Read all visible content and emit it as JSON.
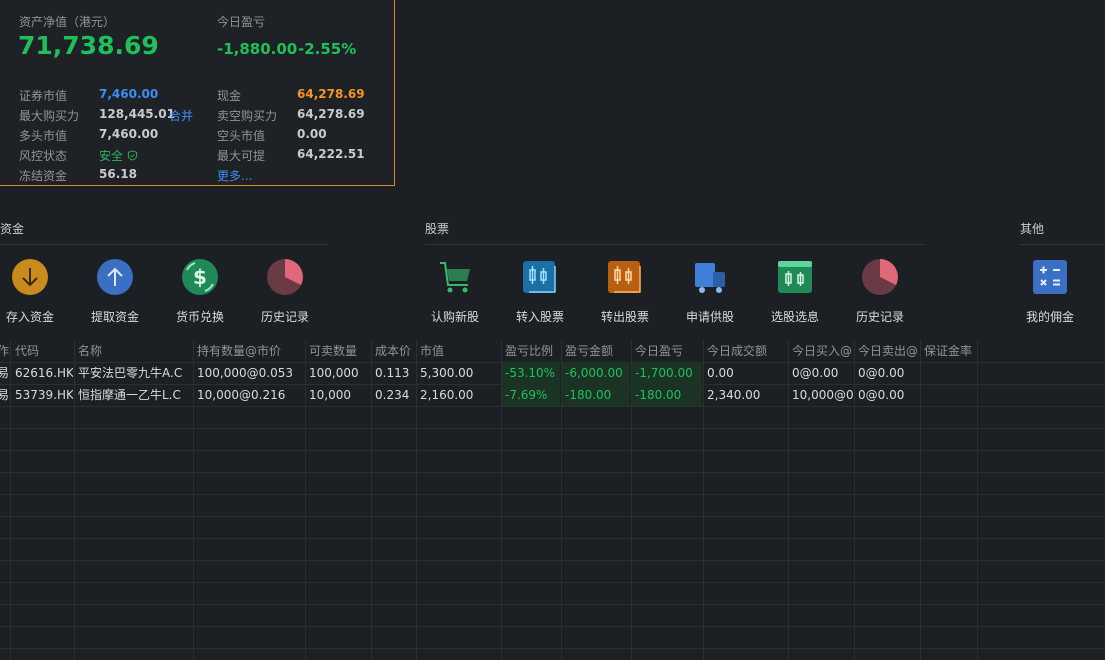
{
  "summary": {
    "nav_label": "资产净值（港元）",
    "nav_value": "71,738.69",
    "today_pl_label": "今日盈亏",
    "today_pl_amount": "-1,880.00",
    "today_pl_pct": "-2.55%",
    "rows": {
      "securities_label": "证券市值",
      "securities_value": "7,460.00",
      "cash_label": "现金",
      "cash_value": "64,278.69",
      "max_buy_label": "最大购买力",
      "max_buy_value": "128,445.01",
      "merge_link": "合并",
      "short_buy_label": "卖空购买力",
      "short_buy_value": "64,278.69",
      "long_label": "多头市值",
      "long_value": "7,460.00",
      "short_label": "空头市值",
      "short_value": "0.00",
      "risk_label": "风控状态",
      "risk_value": "安全",
      "max_withdraw_label": "最大可提",
      "max_withdraw_value": "64,222.51",
      "frozen_label": "冻结资金",
      "frozen_value": "56.18",
      "more_link": "更多..."
    }
  },
  "sections": {
    "funds": "资金",
    "stocks": "股票",
    "other": "其他"
  },
  "actions": {
    "deposit": "存入资金",
    "withdraw": "提取资金",
    "exchange": "货币兑换",
    "history_funds": "历史记录",
    "ipo": "认购新股",
    "transfer_in": "转入股票",
    "transfer_out": "转出股票",
    "apply_lend": "申请供股",
    "screener": "选股选息",
    "history_stocks": "历史记录",
    "commission": "我的佣金"
  },
  "table": {
    "headers": [
      "作",
      "代码",
      "名称",
      "持有数量@市价",
      "可卖数量",
      "成本价",
      "市值",
      "盈亏比例",
      "盈亏金额",
      "今日盈亏",
      "今日成交额",
      "今日买入@",
      "今日卖出@",
      "保证金率"
    ],
    "rows": [
      [
        "易",
        "62616.HK",
        "平安法巴零九牛A.C",
        "100,000@0.053",
        "100,000",
        "0.113",
        "5,300.00",
        "-53.10%",
        "-6,000.00",
        "-1,700.00",
        "0.00",
        "0@0.00",
        "0@0.00",
        ""
      ],
      [
        "易",
        "53739.HK",
        "恒指摩通一乙牛L.C",
        "10,000@0.216",
        "10,000",
        "0.234",
        "2,160.00",
        "-7.69%",
        "-180.00",
        "-180.00",
        "2,340.00",
        "10,000@0.",
        "0@0.00",
        ""
      ]
    ]
  },
  "colors": {
    "accent_border": "#d98a2b",
    "gain_green": "#1fc05a",
    "link_blue": "#3d8df5",
    "cash_orange": "#f7951e"
  }
}
